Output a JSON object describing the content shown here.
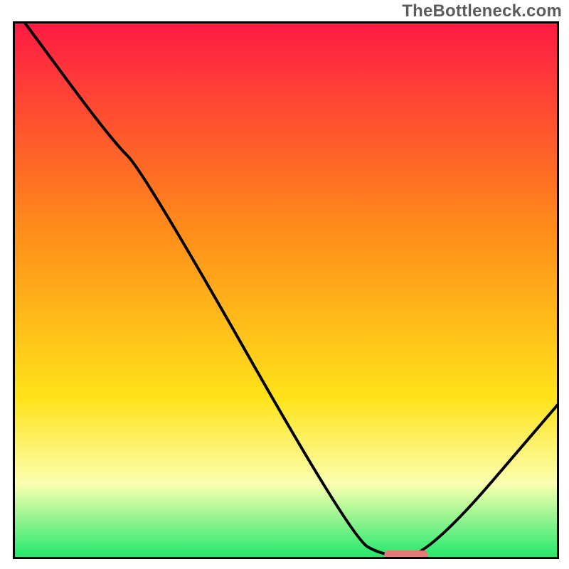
{
  "attribution": "TheBottleneck.com",
  "colors": {
    "red_top": "#ff1a44",
    "orange": "#ff8a1a",
    "yellow": "#ffe31a",
    "pale": "#fbffb0",
    "green": "#1ce86a",
    "line": "#000000",
    "border": "#000000",
    "marker": "#e47a78"
  },
  "chart_data": {
    "type": "line",
    "title": "",
    "xlabel": "",
    "ylabel": "",
    "xlim": [
      0,
      100
    ],
    "ylim": [
      0,
      100
    ],
    "x": [
      2,
      18,
      24,
      62,
      68,
      76,
      100
    ],
    "values": [
      100,
      78,
      72,
      4,
      0.5,
      0.5,
      29
    ],
    "marker": {
      "x_start": 68,
      "x_end": 76,
      "y": 0.8
    },
    "gradient_stops": [
      {
        "pct": 0,
        "key": "red_top"
      },
      {
        "pct": 38,
        "key": "orange"
      },
      {
        "pct": 70,
        "key": "yellow"
      },
      {
        "pct": 86,
        "key": "pale"
      },
      {
        "pct": 100,
        "key": "green"
      }
    ]
  }
}
